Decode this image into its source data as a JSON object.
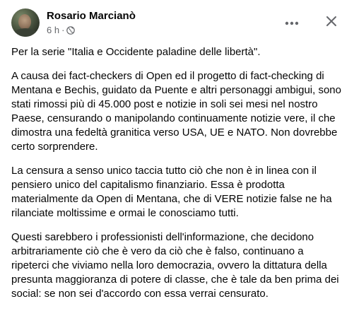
{
  "post": {
    "author": "Rosario Marcianò",
    "time": "6 h",
    "separator": "·",
    "paragraphs": [
      "Per la serie \"Italia e Occidente paladine delle libertà\".",
      "A causa dei fact-checkers di Open ed il progetto di fact-checking di Mentana e Bechis, guidato da Puente e altri personaggi ambigui, sono stati rimossi più di 45.000 post e notizie in soli sei mesi nel nostro Paese, censurando o manipolando continuamente notizie vere, il che dimostra una fedeltà granitica verso USA, UE e NATO. Non dovrebbe certo sorprendere.",
      "La censura a senso unico taccia tutto ciò che non è in linea con il pensiero unico del capitalismo finanziario. Essa è prodotta materialmente da Open di Mentana, che di VERE notizie false ne ha rilanciate moltissime e ormai le conosciamo tutti.",
      "Questi sarebbero i professionisti dell'informazione, che decidono arbitrariamente ciò che è vero da ciò che è falso, continuano a ripeterci che viviamo nella loro democrazia, ovvero la dittatura della presunta maggioranza di potere di classe, che è tale da ben prima dei social: se non sei d'accordo con essa verrai censurato."
    ]
  },
  "icons": {
    "audience": "globe-icon",
    "more": "more-horizontal-icon",
    "close": "close-icon"
  },
  "colors": {
    "text": "#050505",
    "secondary": "#65676b",
    "background": "#ffffff"
  }
}
